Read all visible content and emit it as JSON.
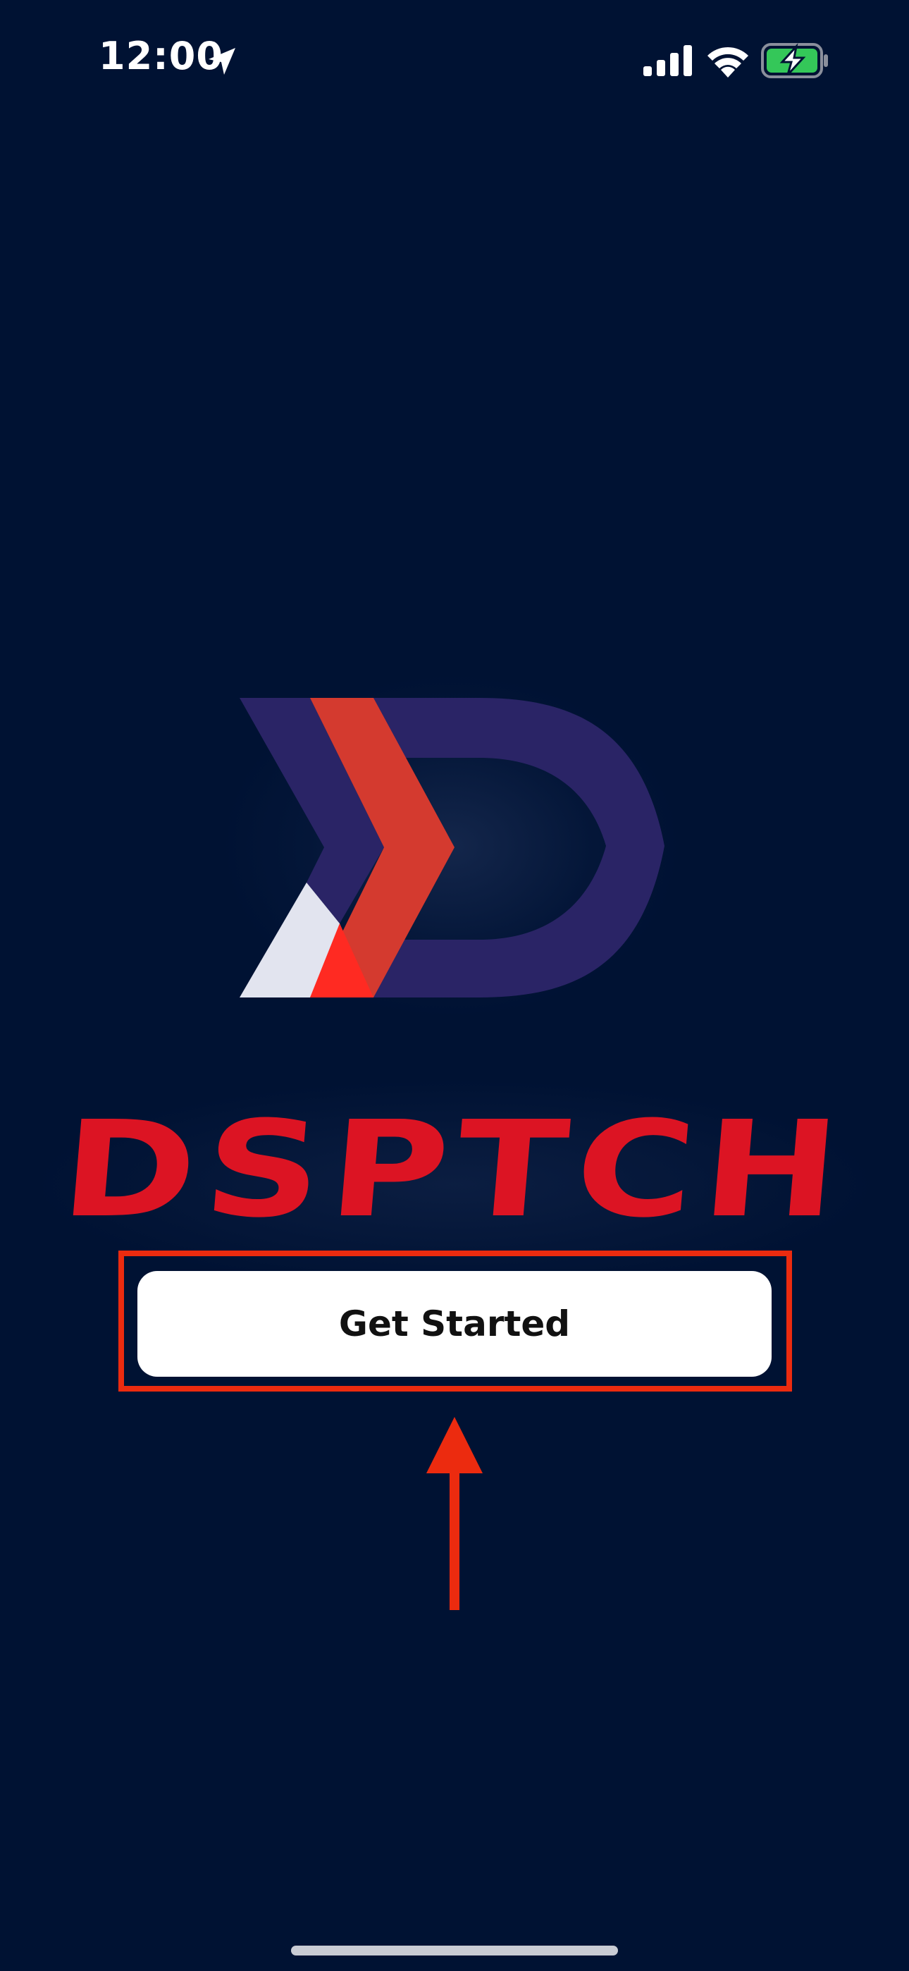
{
  "status_bar": {
    "time": "12:00",
    "icons": [
      "location-arrow-icon",
      "cellular-signal-icon",
      "wifi-icon",
      "battery-charging-icon"
    ],
    "battery_color": "#34c759"
  },
  "brand": {
    "wordmark": "DSPTCH",
    "logo": "dsptch-logo-icon",
    "colors": {
      "navy": "#2a2466",
      "red": "#d43a2f",
      "bright_red": "#ff2a22",
      "light": "#e2e4ef",
      "wordmark_red": "#dc1423",
      "background": "#001233"
    }
  },
  "actions": {
    "get_started_label": "Get Started"
  },
  "annotation": {
    "highlight_color": "#ec2b0f",
    "arrow_icon": "arrow-up-icon"
  }
}
